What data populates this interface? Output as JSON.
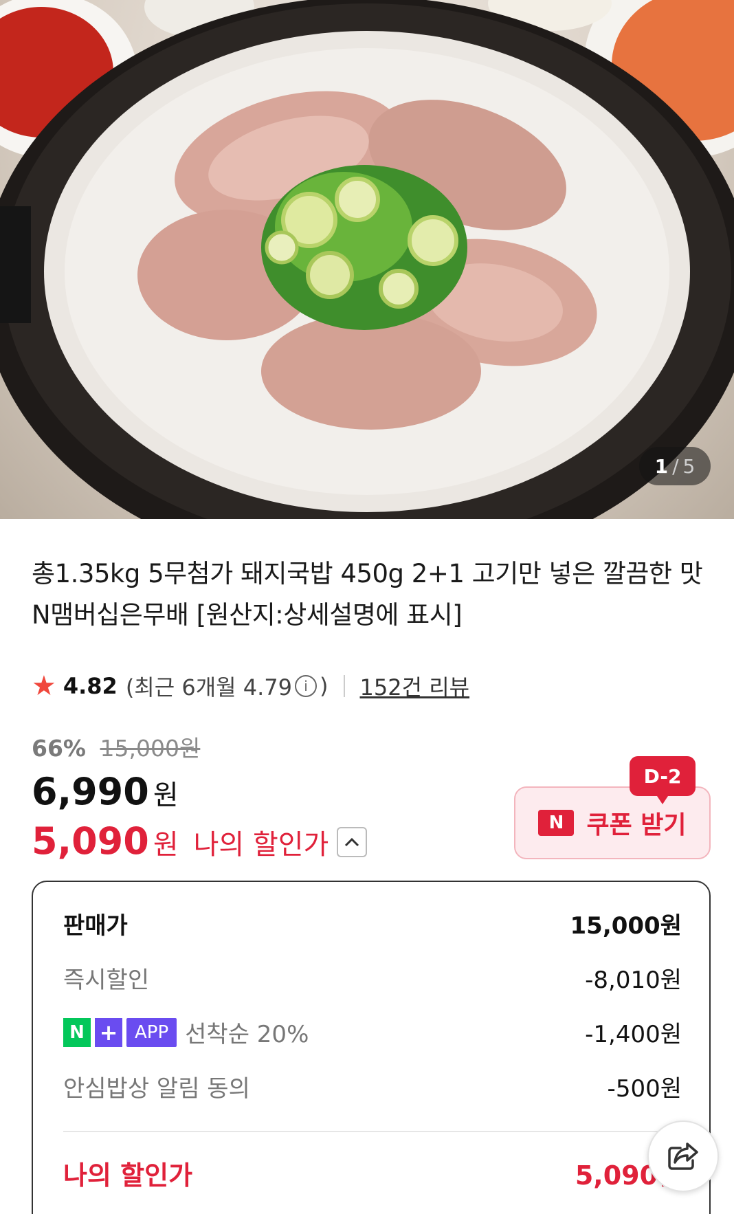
{
  "image_counter": {
    "current": "1",
    "separator": "/",
    "total": "5"
  },
  "product": {
    "title": "총1.35kg 5무첨가 돼지국밥 450g 2+1 고기만 넣은 깔끔한 맛 N맴버십은무배 [원산지:상세설명에 표시]"
  },
  "rating": {
    "score": "4.82",
    "recent": "(최근 6개월 4.79",
    "recent_close": ")",
    "reviews": "152건 리뷰"
  },
  "price": {
    "discount_rate": "66%",
    "original": "15,000원",
    "sale": "6,990",
    "won": "원",
    "my_price": "5,090",
    "my_label": "나의 할인가"
  },
  "coupon": {
    "dday": "D-2",
    "badge": "N",
    "label": "쿠폰 받기"
  },
  "breakdown": {
    "rows": [
      {
        "label": "판매가",
        "value": "15,000원"
      },
      {
        "label": "즉시할인",
        "value": "-8,010원"
      },
      {
        "badge_n": "N",
        "badge_plus": "+",
        "badge_app": "APP",
        "label": "선착순 20%",
        "value": "-1,400원"
      },
      {
        "label": "안심밥상 알림 동의",
        "value": "-500원"
      }
    ],
    "total_label": "나의 할인가",
    "total_value": "5,090원"
  },
  "colors": {
    "accent": "#e0213a",
    "naver_green": "#03c75a",
    "plus_purple": "#6a4cf0",
    "star": "#f0473c"
  },
  "icons": {
    "star": "star-icon",
    "info": "info-icon",
    "collapse": "chevron-up-icon",
    "share": "share-icon"
  }
}
